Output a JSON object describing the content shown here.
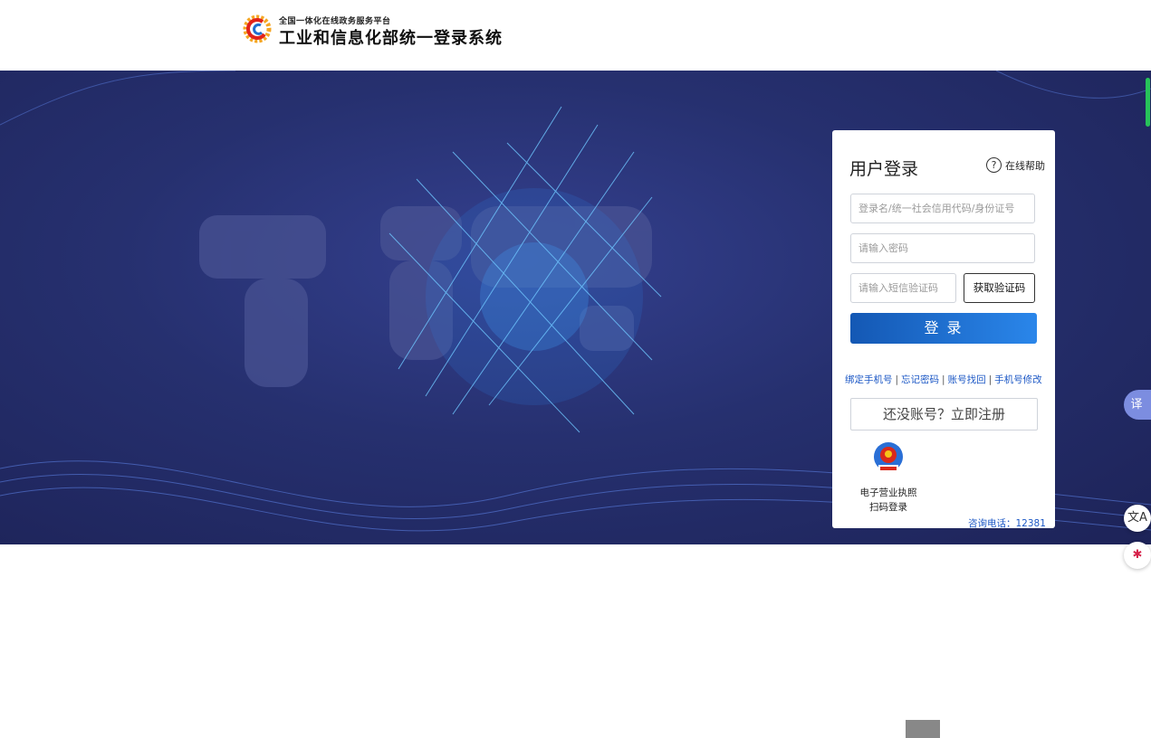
{
  "header": {
    "brand_small": "全国一体化在线政务服务平台",
    "brand_title": "工业和信息化部统一登录系统",
    "logo_icon": "mii-gear-logo-icon"
  },
  "login": {
    "title": "用户登录",
    "help_label": "在线帮助",
    "help_icon": "question-circle-icon",
    "username_placeholder": "登录名/统一社会信用代码/身份证号",
    "password_placeholder": "请输入密码",
    "sms_placeholder": "请输入短信验证码",
    "get_code_label": "获取验证码",
    "login_label": "登 录",
    "links": [
      "绑定手机号",
      "忘记密码",
      "账号找回",
      "手机号修改"
    ],
    "register_label": "还没账号？立即注册",
    "scan_label_1": "电子营业执照",
    "scan_label_2": "扫码登录",
    "hotline": "咨询电话：12381"
  },
  "floating": {
    "translate_label": "译",
    "translate2_icon": "translate-icon",
    "brand_icon": "ai-assistant-icon"
  },
  "colors": {
    "banner_bg": "#26306f",
    "link": "#1b57c5",
    "login_btn": "#1e6fd6"
  }
}
